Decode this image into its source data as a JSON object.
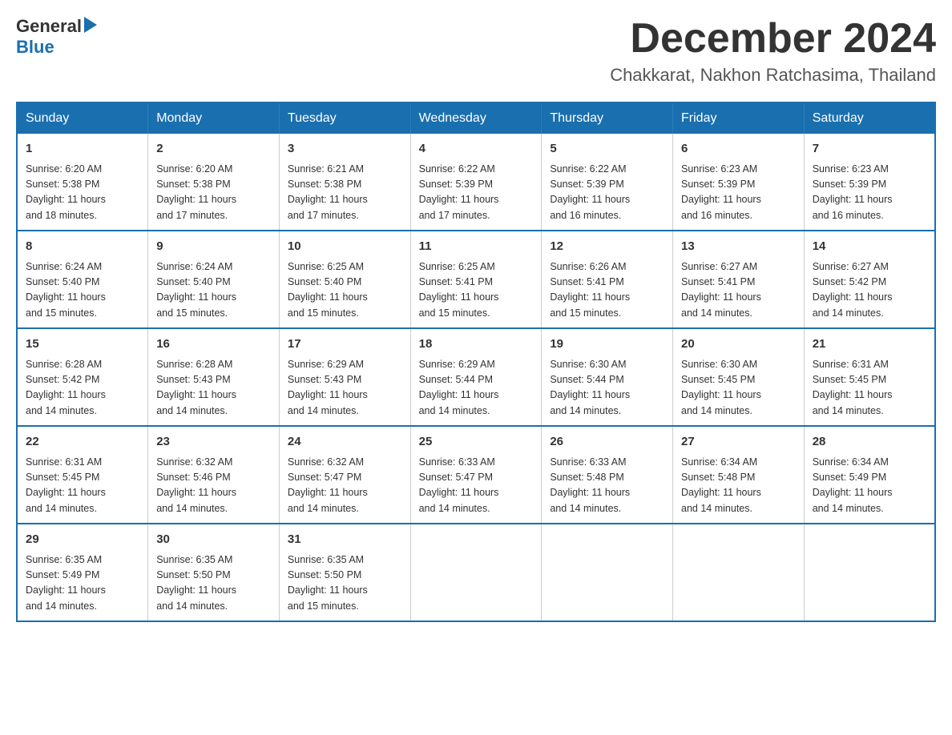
{
  "logo": {
    "general": "General",
    "blue": "Blue"
  },
  "title": {
    "month_year": "December 2024",
    "location": "Chakkarat, Nakhon Ratchasima, Thailand"
  },
  "days_of_week": [
    "Sunday",
    "Monday",
    "Tuesday",
    "Wednesday",
    "Thursday",
    "Friday",
    "Saturday"
  ],
  "weeks": [
    [
      {
        "day": "1",
        "sunrise": "6:20 AM",
        "sunset": "5:38 PM",
        "daylight": "11 hours and 18 minutes."
      },
      {
        "day": "2",
        "sunrise": "6:20 AM",
        "sunset": "5:38 PM",
        "daylight": "11 hours and 17 minutes."
      },
      {
        "day": "3",
        "sunrise": "6:21 AM",
        "sunset": "5:38 PM",
        "daylight": "11 hours and 17 minutes."
      },
      {
        "day": "4",
        "sunrise": "6:22 AM",
        "sunset": "5:39 PM",
        "daylight": "11 hours and 17 minutes."
      },
      {
        "day": "5",
        "sunrise": "6:22 AM",
        "sunset": "5:39 PM",
        "daylight": "11 hours and 16 minutes."
      },
      {
        "day": "6",
        "sunrise": "6:23 AM",
        "sunset": "5:39 PM",
        "daylight": "11 hours and 16 minutes."
      },
      {
        "day": "7",
        "sunrise": "6:23 AM",
        "sunset": "5:39 PM",
        "daylight": "11 hours and 16 minutes."
      }
    ],
    [
      {
        "day": "8",
        "sunrise": "6:24 AM",
        "sunset": "5:40 PM",
        "daylight": "11 hours and 15 minutes."
      },
      {
        "day": "9",
        "sunrise": "6:24 AM",
        "sunset": "5:40 PM",
        "daylight": "11 hours and 15 minutes."
      },
      {
        "day": "10",
        "sunrise": "6:25 AM",
        "sunset": "5:40 PM",
        "daylight": "11 hours and 15 minutes."
      },
      {
        "day": "11",
        "sunrise": "6:25 AM",
        "sunset": "5:41 PM",
        "daylight": "11 hours and 15 minutes."
      },
      {
        "day": "12",
        "sunrise": "6:26 AM",
        "sunset": "5:41 PM",
        "daylight": "11 hours and 15 minutes."
      },
      {
        "day": "13",
        "sunrise": "6:27 AM",
        "sunset": "5:41 PM",
        "daylight": "11 hours and 14 minutes."
      },
      {
        "day": "14",
        "sunrise": "6:27 AM",
        "sunset": "5:42 PM",
        "daylight": "11 hours and 14 minutes."
      }
    ],
    [
      {
        "day": "15",
        "sunrise": "6:28 AM",
        "sunset": "5:42 PM",
        "daylight": "11 hours and 14 minutes."
      },
      {
        "day": "16",
        "sunrise": "6:28 AM",
        "sunset": "5:43 PM",
        "daylight": "11 hours and 14 minutes."
      },
      {
        "day": "17",
        "sunrise": "6:29 AM",
        "sunset": "5:43 PM",
        "daylight": "11 hours and 14 minutes."
      },
      {
        "day": "18",
        "sunrise": "6:29 AM",
        "sunset": "5:44 PM",
        "daylight": "11 hours and 14 minutes."
      },
      {
        "day": "19",
        "sunrise": "6:30 AM",
        "sunset": "5:44 PM",
        "daylight": "11 hours and 14 minutes."
      },
      {
        "day": "20",
        "sunrise": "6:30 AM",
        "sunset": "5:45 PM",
        "daylight": "11 hours and 14 minutes."
      },
      {
        "day": "21",
        "sunrise": "6:31 AM",
        "sunset": "5:45 PM",
        "daylight": "11 hours and 14 minutes."
      }
    ],
    [
      {
        "day": "22",
        "sunrise": "6:31 AM",
        "sunset": "5:45 PM",
        "daylight": "11 hours and 14 minutes."
      },
      {
        "day": "23",
        "sunrise": "6:32 AM",
        "sunset": "5:46 PM",
        "daylight": "11 hours and 14 minutes."
      },
      {
        "day": "24",
        "sunrise": "6:32 AM",
        "sunset": "5:47 PM",
        "daylight": "11 hours and 14 minutes."
      },
      {
        "day": "25",
        "sunrise": "6:33 AM",
        "sunset": "5:47 PM",
        "daylight": "11 hours and 14 minutes."
      },
      {
        "day": "26",
        "sunrise": "6:33 AM",
        "sunset": "5:48 PM",
        "daylight": "11 hours and 14 minutes."
      },
      {
        "day": "27",
        "sunrise": "6:34 AM",
        "sunset": "5:48 PM",
        "daylight": "11 hours and 14 minutes."
      },
      {
        "day": "28",
        "sunrise": "6:34 AM",
        "sunset": "5:49 PM",
        "daylight": "11 hours and 14 minutes."
      }
    ],
    [
      {
        "day": "29",
        "sunrise": "6:35 AM",
        "sunset": "5:49 PM",
        "daylight": "11 hours and 14 minutes."
      },
      {
        "day": "30",
        "sunrise": "6:35 AM",
        "sunset": "5:50 PM",
        "daylight": "11 hours and 14 minutes."
      },
      {
        "day": "31",
        "sunrise": "6:35 AM",
        "sunset": "5:50 PM",
        "daylight": "11 hours and 15 minutes."
      },
      null,
      null,
      null,
      null
    ]
  ],
  "labels": {
    "sunrise": "Sunrise:",
    "sunset": "Sunset:",
    "daylight": "Daylight:"
  }
}
